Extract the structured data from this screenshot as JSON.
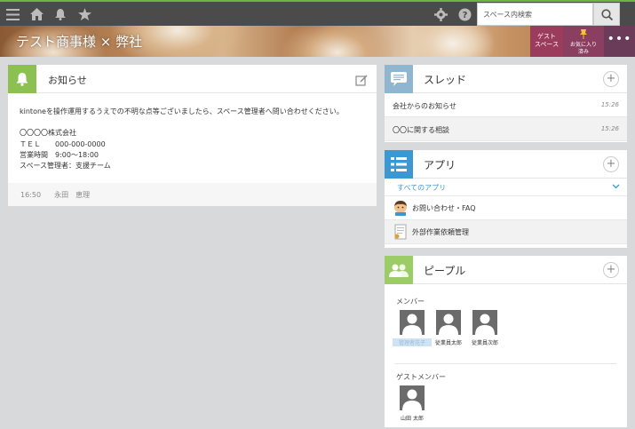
{
  "topbar": {
    "search_placeholder": "スペース内検索"
  },
  "banner": {
    "title": "テスト商事様 × 弊社",
    "guest_line1": "ゲスト",
    "guest_line2": "スペース",
    "fav_line1": "お気に入り",
    "fav_line2": "済み",
    "more": "•••"
  },
  "notice": {
    "title": "お知らせ",
    "lines": [
      "kintoneを操作運用するうえでの不明な点等ございましたら、スペース管理者へ問い合わせください。",
      "〇〇〇〇株式会社",
      "ＴＥＬ　　000-000-0000",
      "営業時間　9:00〜18:00",
      "スペース管理者：支援チーム"
    ],
    "footer_time": "16:50",
    "footer_author": "永田　恵理"
  },
  "threads": {
    "title": "スレッド",
    "items": [
      {
        "label": "会社からのお知らせ",
        "time": "15:26"
      },
      {
        "label": "〇〇に関する相談",
        "time": "15:26"
      }
    ]
  },
  "apps": {
    "title": "アプリ",
    "all_label": "すべてのアプリ",
    "items": [
      {
        "label": "お問い合わせ・FAQ"
      },
      {
        "label": "外部作業依頼管理"
      }
    ]
  },
  "people": {
    "title": "ピープル",
    "members_label": "メンバー",
    "members": [
      {
        "name": "管理者花子"
      },
      {
        "name": "従業員太郎"
      },
      {
        "name": "従業員次郎"
      }
    ],
    "guests_label": "ゲストメンバー",
    "guests": [
      {
        "name": "山田 太郎"
      }
    ]
  },
  "colors": {
    "accent_green": "#8cc152",
    "thread_blue": "#7fb1d2",
    "app_blue": "#3c98d2",
    "people_green": "#9ccc65"
  }
}
